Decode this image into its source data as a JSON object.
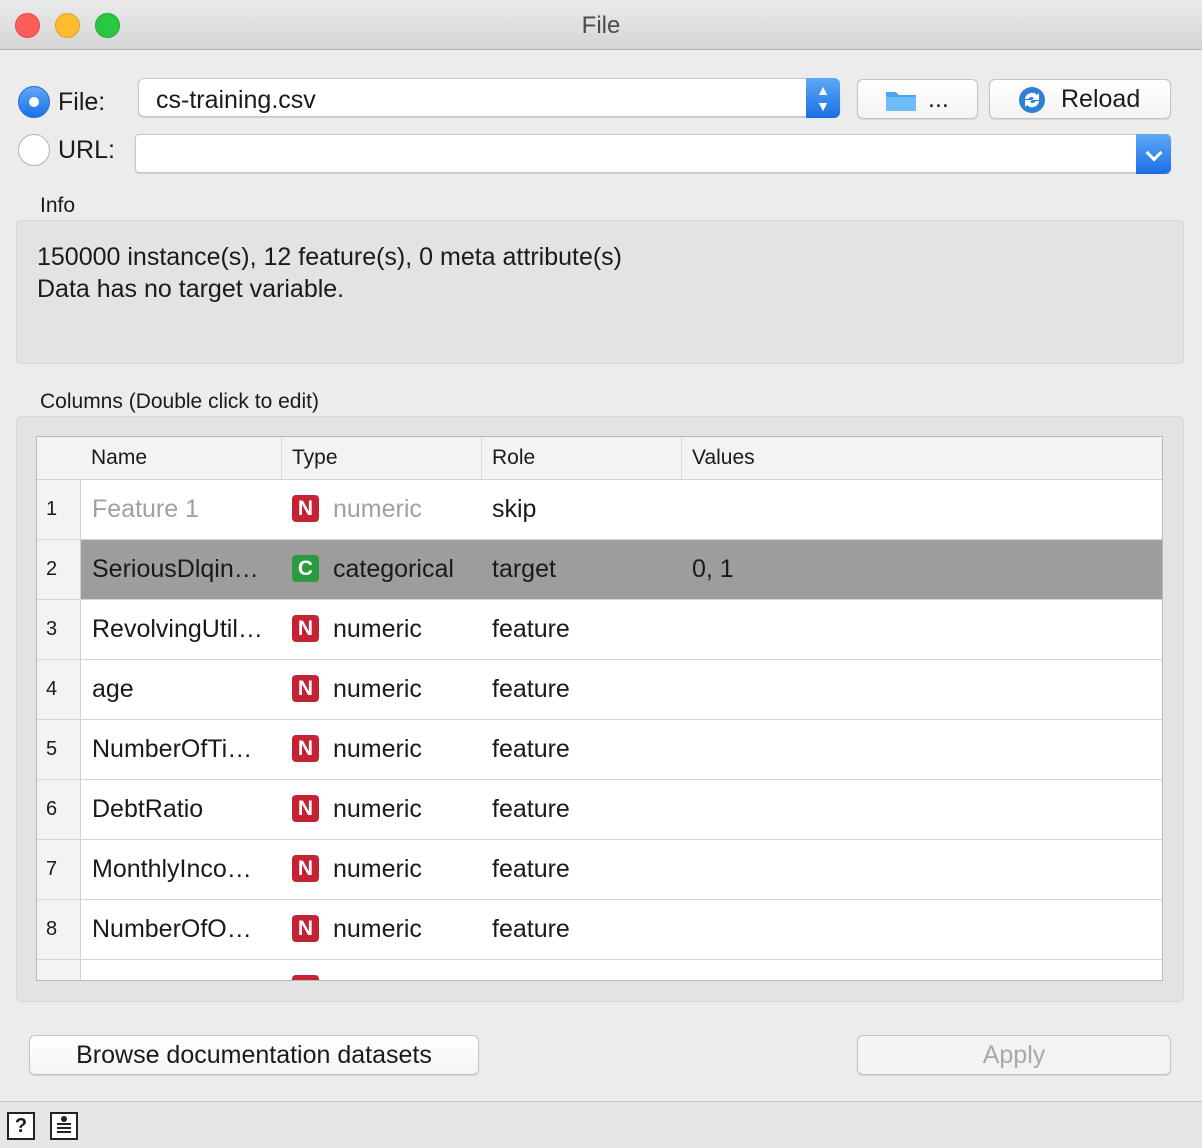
{
  "window": {
    "title": "File"
  },
  "source": {
    "file_label": "File:",
    "file_value": "cs-training.csv",
    "browse_label": "...",
    "reload_label": "Reload",
    "url_label": "URL:",
    "url_value": ""
  },
  "info": {
    "title": "Info",
    "line1": "150000 instance(s), 12 feature(s), 0 meta attribute(s)",
    "line2": "Data has no target variable."
  },
  "columns": {
    "title": "Columns (Double click to edit)",
    "headers": [
      "Name",
      "Type",
      "Role",
      "Values"
    ],
    "rows": [
      {
        "num": "1",
        "name": "Feature 1",
        "badge": "N",
        "type": "numeric",
        "role": "skip",
        "values": ""
      },
      {
        "num": "2",
        "name": "SeriousDlqin…",
        "badge": "C",
        "type": "categorical",
        "role": "target",
        "values": "0, 1"
      },
      {
        "num": "3",
        "name": "RevolvingUtil…",
        "badge": "N",
        "type": "numeric",
        "role": "feature",
        "values": ""
      },
      {
        "num": "4",
        "name": "age",
        "badge": "N",
        "type": "numeric",
        "role": "feature",
        "values": ""
      },
      {
        "num": "5",
        "name": "NumberOfTi…",
        "badge": "N",
        "type": "numeric",
        "role": "feature",
        "values": ""
      },
      {
        "num": "6",
        "name": "DebtRatio",
        "badge": "N",
        "type": "numeric",
        "role": "feature",
        "values": ""
      },
      {
        "num": "7",
        "name": "MonthlyInco…",
        "badge": "N",
        "type": "numeric",
        "role": "feature",
        "values": ""
      },
      {
        "num": "8",
        "name": "NumberOfO…",
        "badge": "N",
        "type": "numeric",
        "role": "feature",
        "values": ""
      }
    ]
  },
  "buttons": {
    "browse_docs": "Browse documentation datasets",
    "apply": "Apply"
  },
  "status": {
    "help_icon": "?",
    "report_icon": "report"
  },
  "colors": {
    "accent": "#1b6fe4",
    "numeric_badge": "#c52333",
    "categorical_badge": "#2a9b3e",
    "selected_row": "#9d9d9d"
  }
}
